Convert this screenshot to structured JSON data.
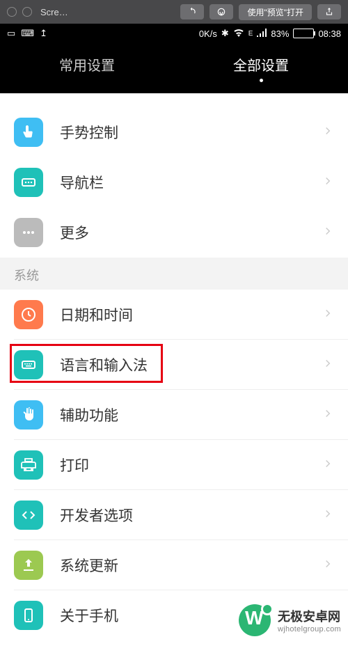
{
  "mac_toolbar": {
    "title": "Scre…",
    "open_with_label": "使用\"预览\"打开"
  },
  "status_bar": {
    "speed": "0K/s",
    "signal_type": "E",
    "battery_pct": "83%",
    "time": "08:38"
  },
  "tabs": {
    "common": "常用设置",
    "all": "全部设置"
  },
  "section1": {
    "gesture": "手势控制",
    "navbar": "导航栏",
    "more": "更多"
  },
  "system_header": "系统",
  "system": {
    "datetime": "日期和时间",
    "language": "语言和输入法",
    "accessibility": "辅助功能",
    "print": "打印",
    "developer": "开发者选项",
    "update": "系统更新",
    "about": "关于手机"
  },
  "watermark": {
    "name": "无极安卓网",
    "url": "wjhotelgroup.com"
  }
}
